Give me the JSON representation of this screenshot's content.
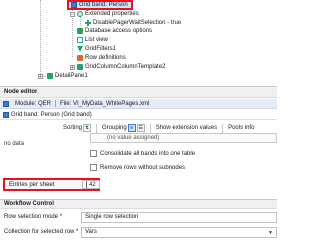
{
  "tree": {
    "selected_node": "Grid band: Person",
    "nodes": [
      {
        "label": "Extended properties"
      },
      {
        "label": "DisablePagerWaitSelection - true"
      },
      {
        "label": "Database access options"
      },
      {
        "label": "List view"
      },
      {
        "label": "GridFilters1"
      },
      {
        "label": "Row definitions"
      },
      {
        "label": "GridColumnColumnTemplate2"
      },
      {
        "label": "DetailPane1"
      }
    ]
  },
  "node_editor": {
    "section_title": "Node editor",
    "module_label": "Module: QER",
    "file_label": "File: VI_MyData_WhitePages.xml",
    "grid_band_label": "Grid band: Person (Grid band)",
    "toolbar": {
      "sorting_label": "Sorting",
      "grouping_label": "Grouping",
      "show_ext_values_label": "Show extension values",
      "pools_info_label": "Pools info"
    },
    "no_data_text": "no data",
    "value_placeholder": "(no value assigned)",
    "consolidate_label": "Consolidate all bands into one table",
    "remove_rows_label": "Remove rows without subnodes",
    "entries_per_sheet_label": "Entries per sheet",
    "entries_per_sheet_value": "42"
  },
  "workflow": {
    "section_title": "Workflow Control",
    "rows": [
      {
        "label": "Row selection mode *",
        "value": "Single row selection"
      },
      {
        "label": "Collection for selected row *",
        "value": "Vars"
      }
    ]
  },
  "colors": {
    "highlight_border": "#e8111f",
    "selection_bg": "#cfe4f8",
    "tree_green": "#26a269",
    "toolbar_active": "#3a7bd5"
  }
}
